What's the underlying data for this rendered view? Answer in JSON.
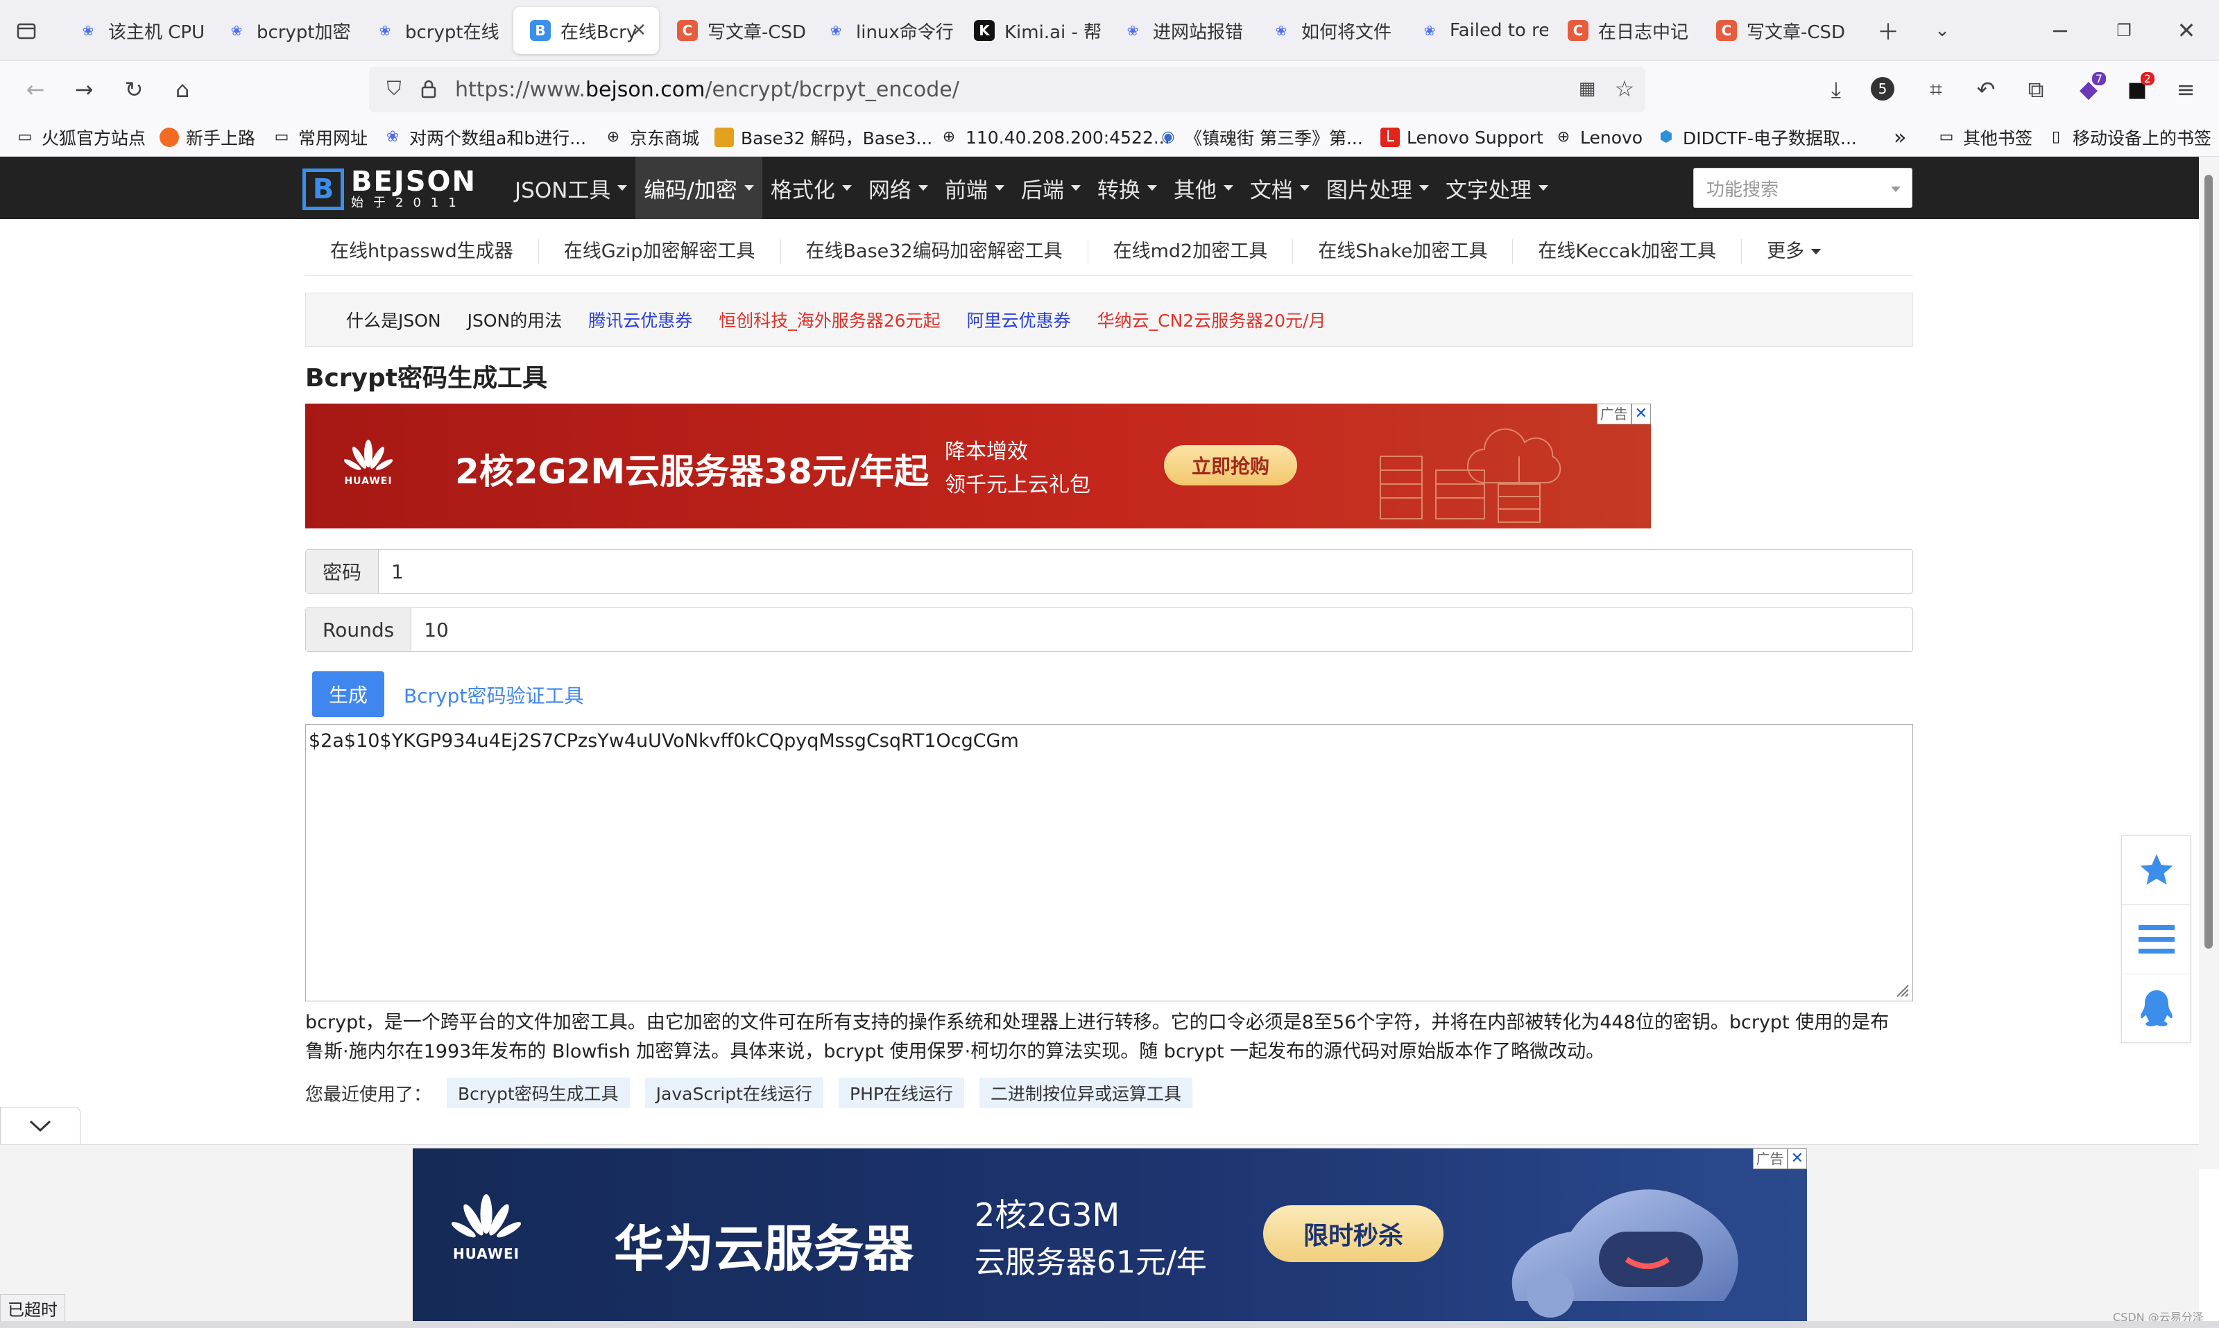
{
  "browser": {
    "tabs": [
      {
        "label": "该主机 CPU",
        "icon": "paw-icon"
      },
      {
        "label": "bcrypt加密",
        "icon": "paw-icon"
      },
      {
        "label": "bcrypt在线",
        "icon": "paw-icon"
      },
      {
        "label": "在线Bcry",
        "icon": "bejson-icon"
      },
      {
        "label": "写文章-CSD",
        "icon": "csdn-icon"
      },
      {
        "label": "linux命令行",
        "icon": "paw-icon"
      },
      {
        "label": "Kimi.ai - 帮",
        "icon": "kimi-icon"
      },
      {
        "label": "进网站报错",
        "icon": "paw-icon"
      },
      {
        "label": "如何将文件",
        "icon": "paw-icon"
      },
      {
        "label": "Failed to re",
        "icon": "paw-icon"
      },
      {
        "label": "在日志中记",
        "icon": "csdn-icon"
      },
      {
        "label": "写文章-CSD",
        "icon": "csdn-icon"
      }
    ],
    "url_prefix": "https://www.",
    "url_domain": "bejson.com",
    "url_path": "/encrypt/bcrpyt_encode/",
    "badges": {
      "ext1": "5",
      "ext2": "7",
      "ext3": "2"
    },
    "bookmarks": [
      "火狐官方站点",
      "新手上路",
      "常用网址",
      "对两个数组a和b进行...",
      "京东商城",
      "Base32 解码，Base3...",
      "110.40.208.200:4522...",
      "《镇魂街 第三季》第...",
      "Lenovo Support",
      "Lenovo",
      "DIDCTF-电子数据取...",
      "其他书签",
      "移动设备上的书签"
    ]
  },
  "site": {
    "logo_main": "BEJSON",
    "logo_sub": "始于2011",
    "nav": [
      "JSON工具",
      "编码/加密",
      "格式化",
      "网络",
      "前端",
      "后端",
      "转换",
      "其他",
      "文档",
      "图片处理",
      "文字处理"
    ],
    "search_placeholder": "功能搜索",
    "subnav": [
      "在线htpasswd生成器",
      "在线Gzip加密解密工具",
      "在线Base32编码加密解密工具",
      "在线md2加密工具",
      "在线Shake加密工具",
      "在线Keccak加密工具",
      "更多"
    ],
    "links": [
      {
        "text": "什么是JSON",
        "color": "#222222"
      },
      {
        "text": "JSON的用法",
        "color": "#222222"
      },
      {
        "text": "腾讯云优惠券",
        "color": "#2a3fd6"
      },
      {
        "text": "恒创科技_海外服务器26元起",
        "color": "#e0312a"
      },
      {
        "text": "阿里云优惠券",
        "color": "#2a3fd6"
      },
      {
        "text": "华纳云_CN2云服务器20元/月",
        "color": "#e0312a"
      }
    ]
  },
  "page": {
    "title": "Bcrypt密码生成工具",
    "password_label": "密码",
    "password_value": "1",
    "rounds_label": "Rounds",
    "rounds_value": "10",
    "generate_button": "生成",
    "verify_link": "Bcrypt密码验证工具",
    "output": "$2a$10$YKGP934u4Ej2S7CPzsYw4uUVoNkvff0kCQpyqMssgCsqRT1OcgCGm",
    "description": "bcrypt，是一个跨平台的文件加密工具。由它加密的文件可在所有支持的操作系统和处理器上进行转移。它的口令必须是8至56个字符，并将在内部被转化为448位的密钥。bcrypt 使用的是布鲁斯·施内尔在1993年发布的 Blowfish 加密算法。具体来说，bcrypt 使用保罗·柯切尔的算法实现。随 bcrypt 一起发布的源代码对原始版本作了略微改动。",
    "recent_label": "您最近使用了：",
    "recent": [
      "Bcrypt密码生成工具",
      "JavaScript在线运行",
      "PHP在线运行",
      "二进制按位异或运算工具"
    ]
  },
  "ads": {
    "ad1": {
      "brand": "HUAWEI",
      "headline": "2核2G2M云服务器38元/年起",
      "line1": "降本增效",
      "line2": "领千元上云礼包",
      "cta": "立即抢购",
      "tag": "广告"
    },
    "ad2": {
      "brand": "HUAWEI",
      "headline": "华为云服务器",
      "line1": "2核2G3M",
      "line2": "云服务器61元/年",
      "cta": "限时秒杀",
      "tag": "广告"
    }
  },
  "status": {
    "timeout": "已超时",
    "watermark": "CSDN @云易分泽"
  },
  "colors": {
    "header_bg": "#222222",
    "accent_blue": "#3f86ef",
    "ad_red": "#c4261c",
    "ad_navy": "#1d3470"
  }
}
